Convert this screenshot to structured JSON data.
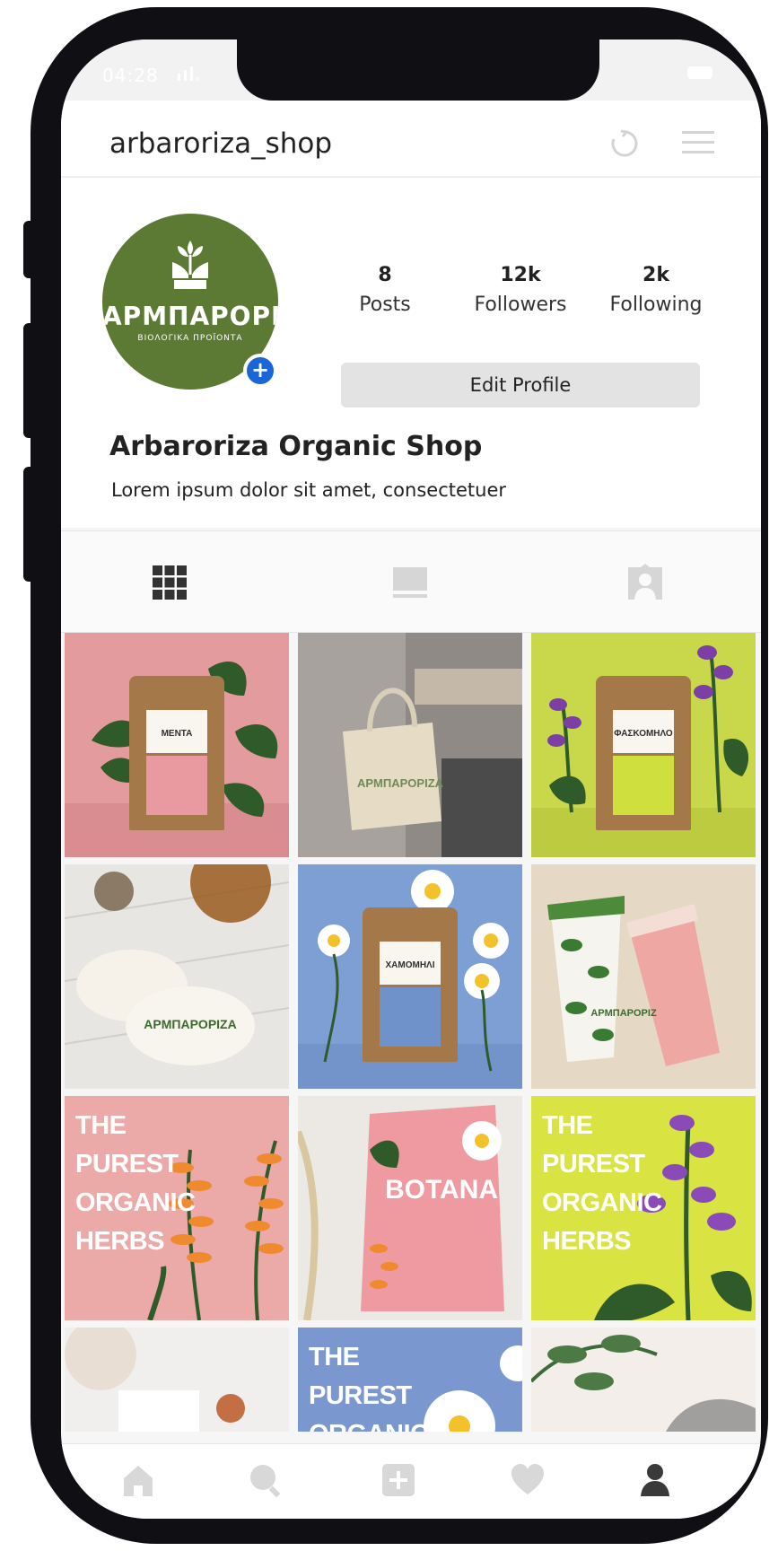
{
  "status_bar": {
    "time": "04:28"
  },
  "header": {
    "username": "arbaroriza_shop"
  },
  "profile": {
    "avatar_wordmark": "ΑΡΜΠΑΡΟΡΙΖΑ",
    "avatar_subtitle": "ΒΙΟΛΟΓΙΚΑ ΠΡΟΪΟΝΤΑ",
    "stats": [
      {
        "value": "8",
        "label": "Posts"
      },
      {
        "value": "12k",
        "label": "Followers"
      },
      {
        "value": "2k",
        "label": "Following"
      }
    ],
    "edit_button": "Edit Profile",
    "display_name": "Arbaroriza Organic Shop",
    "bio": "Lorem ipsum dolor sit amet, consectetuer"
  },
  "tabs": [
    "grid-icon",
    "feed-icon",
    "tagged-icon"
  ],
  "posts": [
    {
      "label": "ΜΕΝΤΑ",
      "bg": "#e49b9d"
    },
    {
      "label": "ΑΡΜΠΑΡΟΡΙΖΑ",
      "bg": "#8f8a86"
    },
    {
      "label": "ΦΑΣΚΟΜΗΛΟ",
      "bg": "#c9d84a"
    },
    {
      "label": "ΑΡΜΠΑΡΟΡΙΖΑ",
      "bg": "#e8e6e3"
    },
    {
      "label": "ΧΑΜΟΜΗΛΙ",
      "bg": "#7e9fd4"
    },
    {
      "label": "ΑΡΜΠΑΡΟΡΙΖ",
      "bg": "#e5d9c6"
    },
    {
      "headline": "THE PUREST ORGANIC HERBS",
      "bg": "#eba9a8"
    },
    {
      "label": "BOTANA",
      "bg": "#ece9e4"
    },
    {
      "headline": "THE PUREST ORGANIC HERBS",
      "bg": "#d9e341"
    },
    {
      "bg": "#f1efed"
    },
    {
      "headline": "THE PUREST ORGANIC HERBS",
      "bg": "#7a98cf"
    },
    {
      "bg": "#f3eeea"
    }
  ],
  "bottom_nav": [
    "home-icon",
    "search-icon",
    "add-post-icon",
    "heart-icon",
    "profile-icon"
  ],
  "colors": {
    "accent": "#1a66d8",
    "brand_green": "#5d7a35",
    "leaf": "#3a6b2f",
    "orange": "#f08a2e",
    "purple": "#8a4bb8"
  }
}
